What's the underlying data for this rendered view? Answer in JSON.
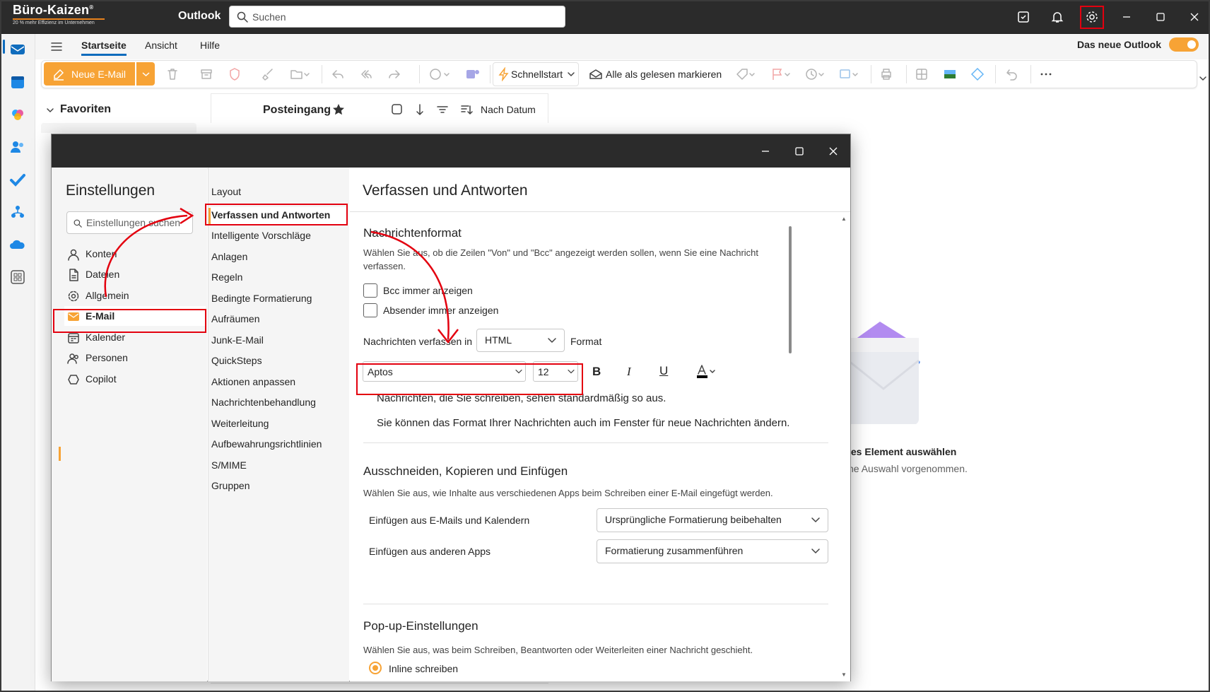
{
  "app": {
    "logo_title": "Büro-Kaizen",
    "logo_reg": "®",
    "logo_tagline": "20 % mehr Effizienz im Unternehmen",
    "name": "Outlook",
    "search_placeholder": "Suchen",
    "new_outlook_label": "Das neue Outlook",
    "new_outlook_on": true
  },
  "ribbon": {
    "tabs": [
      "Startseite",
      "Ansicht",
      "Hilfe"
    ],
    "active_tab": "Startseite",
    "new_mail": "Neue E-Mail",
    "quickstart": "Schnellstart",
    "mark_read": "Alle als gelesen markieren"
  },
  "mail": {
    "favorites": "Favoriten",
    "inbox": "Posteingang",
    "sort": "Nach Datum",
    "empty_title": "les Element auswählen",
    "empty_sub": "ne Auswahl vorgenommen."
  },
  "settings": {
    "title": "Einstellungen",
    "search_placeholder": "Einstellungen suchen",
    "categories": [
      "Konten",
      "Dateien",
      "Allgemein",
      "E-Mail",
      "Kalender",
      "Personen",
      "Copilot"
    ],
    "selected_category": "E-Mail",
    "subcategories": [
      "Layout",
      "Verfassen und Antworten",
      "Intelligente Vorschläge",
      "Anlagen",
      "Regeln",
      "Bedingte Formatierung",
      "Aufräumen",
      "Junk-E-Mail",
      "QuickSteps",
      "Aktionen anpassen",
      "Nachrichtenbehandlung",
      "Weiterleitung",
      "Aufbewahrungsrichtlinien",
      "S/MIME",
      "Gruppen"
    ],
    "selected_subcategory": "Verfassen und Antworten"
  },
  "content": {
    "heading": "Verfassen und Antworten",
    "format": {
      "title": "Nachrichtenformat",
      "desc": "Wählen Sie aus, ob die Zeilen \"Von\" und \"Bcc\" angezeigt werden sollen, wenn Sie eine Nachricht verfassen.",
      "bcc": "Bcc immer anzeigen",
      "from": "Absender immer anzeigen",
      "compose_label": "Nachrichten verfassen in",
      "compose_value": "HTML",
      "compose_suffix": "Format",
      "font": "Aptos",
      "size": "12",
      "sample1": "Nachrichten, die Sie schreiben, sehen standardmäßig so aus.",
      "sample2": "Sie können das Format Ihrer Nachrichten auch im Fenster für neue Nachrichten ändern."
    },
    "paste": {
      "title": "Ausschneiden, Kopieren und Einfügen",
      "desc": "Wählen Sie aus, wie Inhalte aus verschiedenen Apps beim Schreiben einer E-Mail eingefügt werden.",
      "row1_label": "Einfügen aus E-Mails und Kalendern",
      "row1_value": "Ursprüngliche Formatierung beibehalten",
      "row2_label": "Einfügen aus anderen Apps",
      "row2_value": "Formatierung zusammenführen"
    },
    "popup": {
      "title": "Pop-up-Einstellungen",
      "desc": "Wählen Sie aus, was beim Schreiben, Beantworten oder Weiterleiten einer Nachricht geschieht.",
      "option1": "Inline schreiben"
    }
  },
  "colors": {
    "accent": "#f7a335",
    "annotation": "#e3000f",
    "titlebar": "#2b2b2b"
  }
}
